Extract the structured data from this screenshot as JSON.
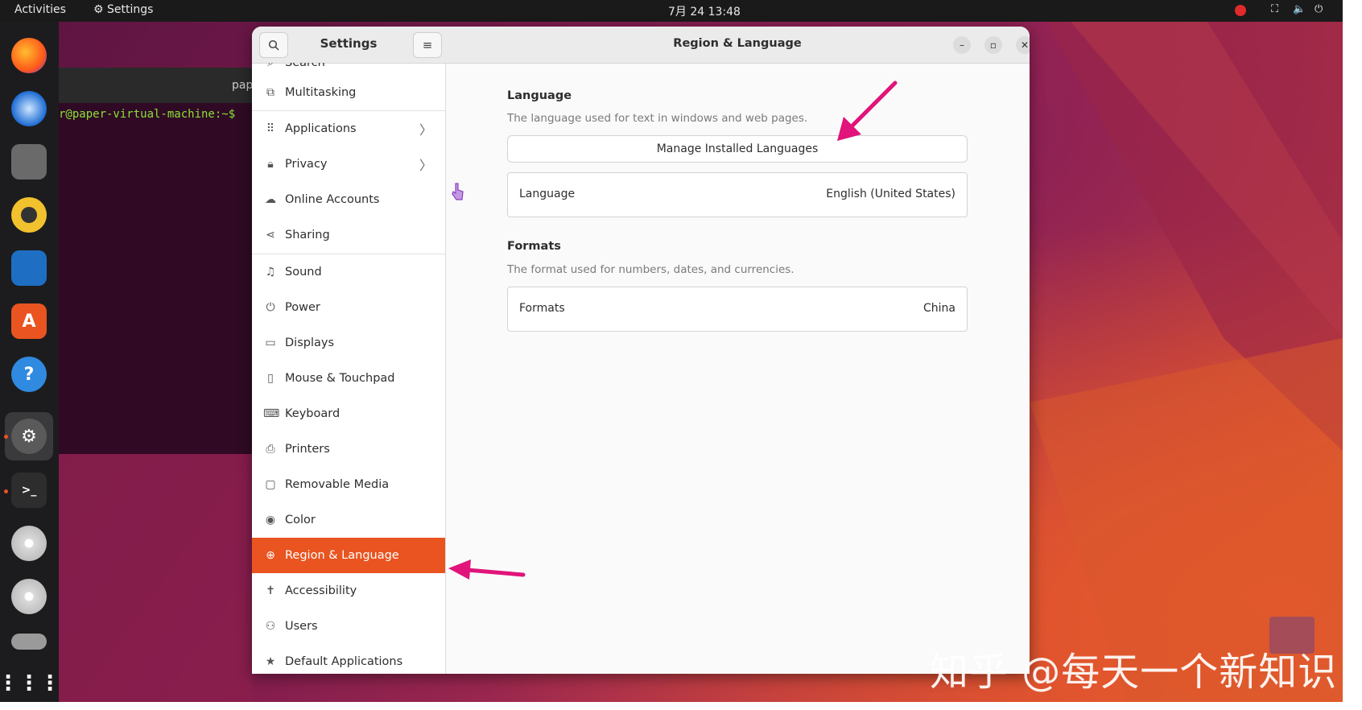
{
  "topbar": {
    "activities": "Activities",
    "app_name": "Settings",
    "clock": "7月 24  13:48"
  },
  "terminal": {
    "title": "pap",
    "prompt": "r@paper-virtual-machine:~$"
  },
  "sidebar": {
    "title": "Settings",
    "partial_top_item": "Search",
    "items": [
      {
        "label": "Multitasking",
        "icon": "multitasking-icon"
      },
      {
        "label": "Applications",
        "icon": "applications-icon",
        "chevron": true
      },
      {
        "label": "Privacy",
        "icon": "lock-icon",
        "chevron": true
      },
      {
        "label": "Online Accounts",
        "icon": "cloud-icon"
      },
      {
        "label": "Sharing",
        "icon": "share-icon"
      },
      {
        "label": "Sound",
        "icon": "music-note-icon"
      },
      {
        "label": "Power",
        "icon": "power-icon"
      },
      {
        "label": "Displays",
        "icon": "display-icon"
      },
      {
        "label": "Mouse & Touchpad",
        "icon": "mouse-icon"
      },
      {
        "label": "Keyboard",
        "icon": "keyboard-icon"
      },
      {
        "label": "Printers",
        "icon": "printer-icon"
      },
      {
        "label": "Removable Media",
        "icon": "removable-media-icon"
      },
      {
        "label": "Color",
        "icon": "color-icon"
      },
      {
        "label": "Region & Language",
        "icon": "globe-icon",
        "active": true
      },
      {
        "label": "Accessibility",
        "icon": "accessibility-icon"
      },
      {
        "label": "Users",
        "icon": "users-icon"
      },
      {
        "label": "Default Applications",
        "icon": "star-icon"
      }
    ]
  },
  "content": {
    "title": "Region & Language",
    "language_section": {
      "title": "Language",
      "description": "The language used for text in windows and web pages.",
      "manage_button": "Manage Installed Languages",
      "row_label": "Language",
      "row_value": "English (United States)"
    },
    "formats_section": {
      "title": "Formats",
      "description": "The format used for numbers, dates, and currencies.",
      "row_label": "Formats",
      "row_value": "China"
    }
  },
  "watermark": "知乎 @每天一个新知识",
  "colors": {
    "accent": "#e95420",
    "arrow": "#e0147a"
  }
}
